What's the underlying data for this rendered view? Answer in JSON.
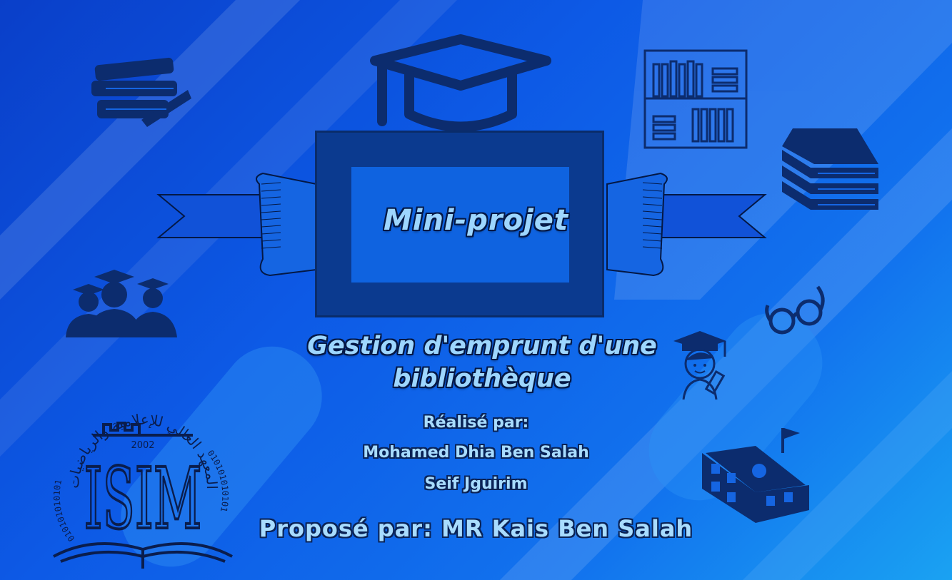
{
  "slide": {
    "title": "Mini-projet",
    "subtitle_line1": "Gestion d'emprunt d'une",
    "subtitle_line2": "bibliothèque",
    "realise_label": "Réalisé par:",
    "authors": [
      "Mohamed Dhia Ben Salah",
      "Seif Jguirim"
    ],
    "propose": "Proposé par: MR Kais Ben Salah"
  },
  "logo": {
    "year": "2002",
    "letters": "ISIM",
    "arabic_text": "المعهد العالي للإعلامية والرياضيات",
    "binary_text": "010101010101"
  },
  "icons": [
    "books-stack-icon",
    "graduation-cap-icon",
    "bookshelf-icon",
    "closed-books-icon",
    "graduates-icon",
    "glasses-icon",
    "student-icon",
    "school-icon"
  ],
  "colors": {
    "dark_navy": "#0c2c6e",
    "frame": "#0b3a8f",
    "text_fill": "#9dd6ff"
  }
}
